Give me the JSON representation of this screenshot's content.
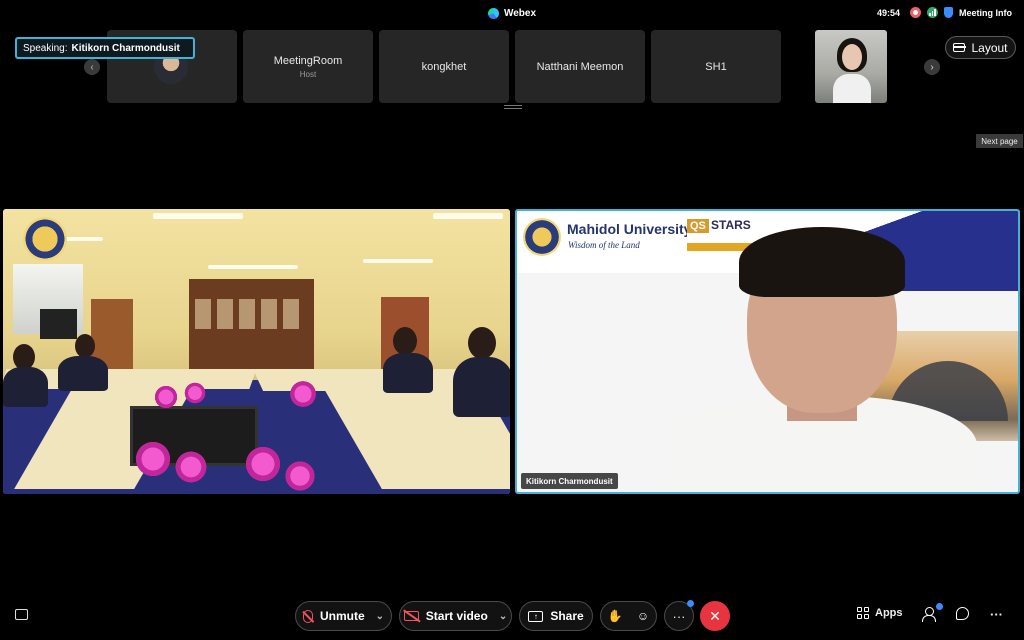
{
  "app": {
    "title": "Webex"
  },
  "status": {
    "timer": "49:54",
    "meeting_info_label": "Meeting Info"
  },
  "speaking": {
    "prefix": "Speaking:",
    "name": "Kitikorn Charmondusit"
  },
  "filmstrip": {
    "tiles": [
      {
        "name": "MeetingRoom",
        "sub": "Host"
      },
      {
        "name": "kongkhet",
        "sub": ""
      },
      {
        "name": "Natthani Meemon",
        "sub": ""
      },
      {
        "name": "SH1",
        "sub": ""
      }
    ],
    "prev_icon": "chevron-left-icon",
    "next_icon": "chevron-right-icon"
  },
  "layout_button": {
    "label": "Layout"
  },
  "tooltip": {
    "text": "Next page"
  },
  "video_right": {
    "name_tag": "Kitikorn Charmondusit",
    "banner_university": "Mahidol University",
    "banner_tagline": "Wisdom of the Land",
    "banner_qs": "QS",
    "banner_stars": "STARS"
  },
  "controls": {
    "unmute_label": "Unmute",
    "start_video_label": "Start video",
    "share_label": "Share",
    "more_label": "···",
    "end_icon": "✕",
    "apps_label": "Apps",
    "overflow_label": "···"
  },
  "colors": {
    "accent": "#3fb4d8",
    "end_call": "#e8343e",
    "muted": "#f2535a",
    "background": "#000000"
  }
}
